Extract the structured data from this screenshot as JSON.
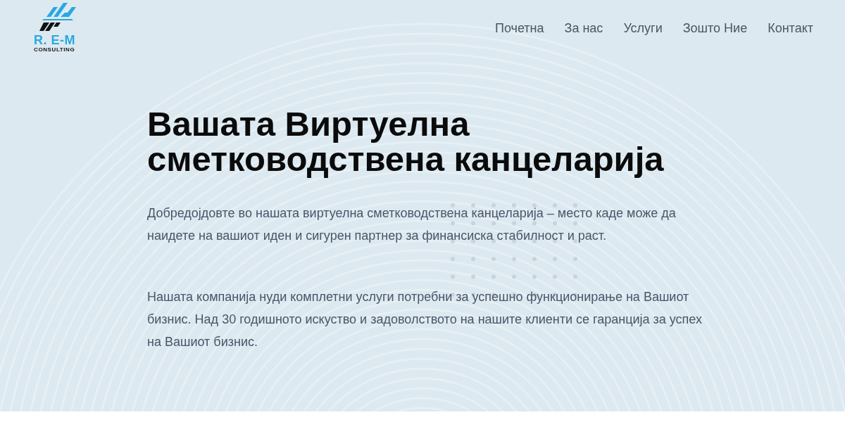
{
  "logo": {
    "name": "R. E-M",
    "tagline": "CONSULTING"
  },
  "nav": [
    {
      "label": "Почетна"
    },
    {
      "label": "За нас"
    },
    {
      "label": "Услуги"
    },
    {
      "label": "Зошто Ние"
    },
    {
      "label": "Контакт"
    }
  ],
  "hero": {
    "title_lines": [
      "Вашата Виртуелна",
      "сметководствена канцеларија"
    ],
    "paragraphs": [
      "Добредојдовте во нашата виртуелна сметководствена канцеларија – место каде може да наидете на вашиот иден и сигурен партнер за финансиска стабилност и раст.",
      "Нашата компанија нуди комплетни услуги потребни за успешно функционирање на Вашиот бизнис. Над 30 годишното искуство и задоволството на нашите клиенти се гаранција за успех на Вашиот бизнис."
    ]
  }
}
